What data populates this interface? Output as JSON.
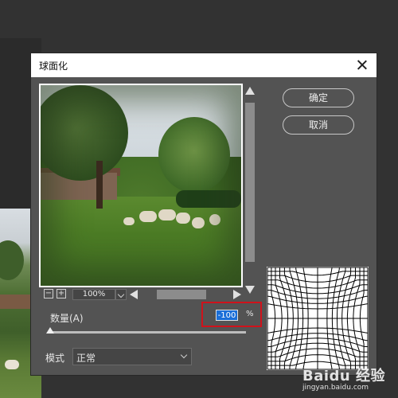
{
  "dialog": {
    "title": "球面化",
    "ok_label": "确定",
    "cancel_label": "取消"
  },
  "preview": {
    "zoom_value": "100%"
  },
  "amount": {
    "label": "数量(A)",
    "value": "-100",
    "unit": "%",
    "slider_level_fraction": 0.0
  },
  "mode": {
    "label": "模式",
    "selected": "正常"
  },
  "watermark": {
    "main": "Baidu 经验",
    "sub": "jingyan.baidu.com"
  },
  "colors": {
    "dialog_bg": "#535353",
    "highlight_red": "#d0121b",
    "selection_blue": "#1a6ed8"
  }
}
